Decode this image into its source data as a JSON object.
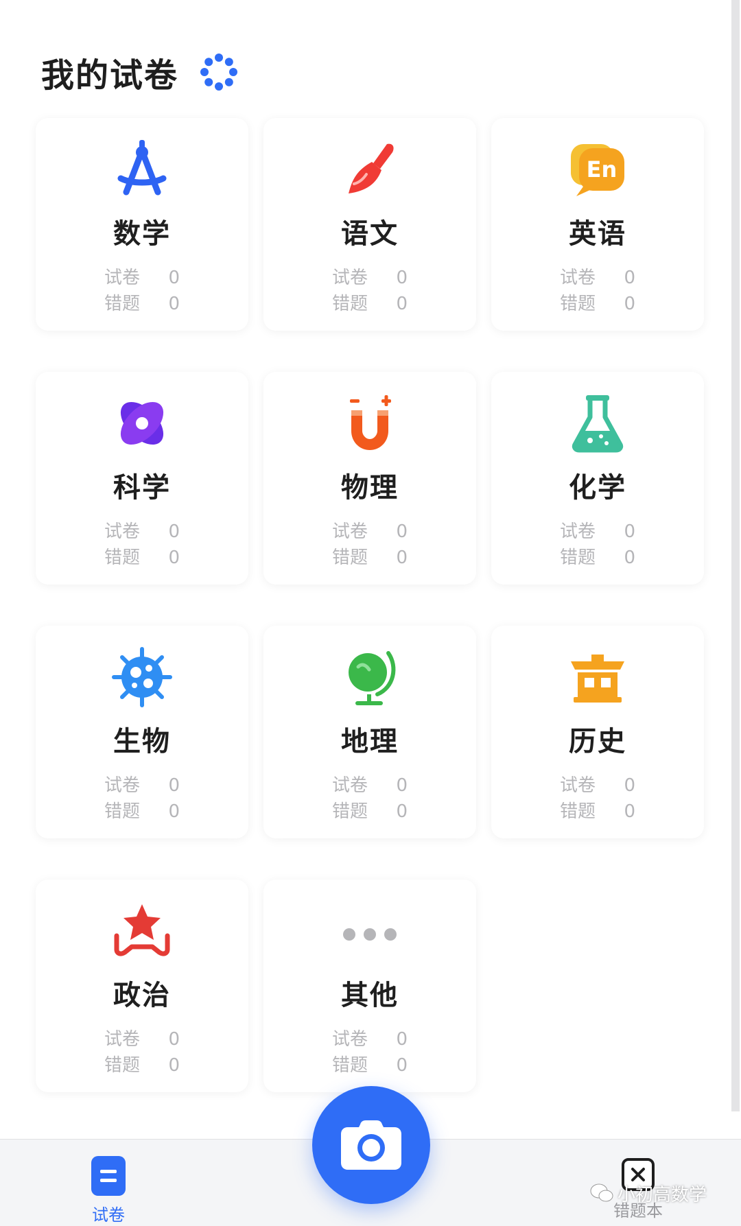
{
  "header": {
    "title": "我的试卷"
  },
  "labels": {
    "papers": "试卷",
    "wrong": "错题"
  },
  "subjects": [
    {
      "name": "数学",
      "papers": "0",
      "wrong": "0",
      "icon": "compass-icon",
      "color": "#2e63f3"
    },
    {
      "name": "语文",
      "papers": "0",
      "wrong": "0",
      "icon": "brush-icon",
      "color": "#f03b35"
    },
    {
      "name": "英语",
      "papers": "0",
      "wrong": "0",
      "icon": "english-bubble-icon",
      "color": "#f5a31f",
      "icon_text": "En"
    },
    {
      "name": "科学",
      "papers": "0",
      "wrong": "0",
      "icon": "atom-icon",
      "color": "#6a2ee8"
    },
    {
      "name": "物理",
      "papers": "0",
      "wrong": "0",
      "icon": "magnet-icon",
      "color": "#f25a1d"
    },
    {
      "name": "化学",
      "papers": "0",
      "wrong": "0",
      "icon": "flask-icon",
      "color": "#3fbf9c"
    },
    {
      "name": "生物",
      "papers": "0",
      "wrong": "0",
      "icon": "virus-icon",
      "color": "#2f8ef3"
    },
    {
      "name": "地理",
      "papers": "0",
      "wrong": "0",
      "icon": "globe-icon",
      "color": "#3bb84a"
    },
    {
      "name": "历史",
      "papers": "0",
      "wrong": "0",
      "icon": "pavilion-icon",
      "color": "#f5a31f"
    },
    {
      "name": "政治",
      "papers": "0",
      "wrong": "0",
      "icon": "star-badge-icon",
      "color": "#e43b35"
    },
    {
      "name": "其他",
      "papers": "0",
      "wrong": "0",
      "icon": "more-dots-icon",
      "color": "#b5b5b8"
    }
  ],
  "bottom_nav": {
    "papers_label": "试卷",
    "wrong_label": "错题本",
    "accent": "#2f6df6"
  },
  "watermark": {
    "text": "小初高数学"
  }
}
